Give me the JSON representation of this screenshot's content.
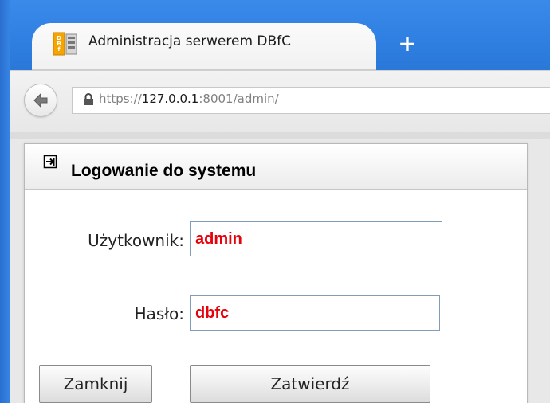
{
  "browser": {
    "tab": {
      "title": "Administracja serwerem DBfC",
      "favicon": "dbfc-favicon-icon"
    },
    "new_tab_label": "+",
    "address_bar": {
      "scheme": "https://",
      "host": "127.0.0.1",
      "rest": ":8001/admin/"
    },
    "icons": {
      "back": "back-arrow-icon",
      "lock": "lock-icon"
    }
  },
  "dialog": {
    "title": "Logowanie do systemu",
    "icon": "login-icon",
    "fields": {
      "user_label": "Użytkownik:",
      "user_value": "admin",
      "password_label": "Hasło:",
      "password_value": "dbfc"
    },
    "buttons": {
      "close": "Zamknij",
      "submit": "Zatwierdź"
    }
  },
  "colors": {
    "chrome_blue": "#2f80e2",
    "input_text": "#e8000a",
    "input_border": "#7f9db9"
  }
}
